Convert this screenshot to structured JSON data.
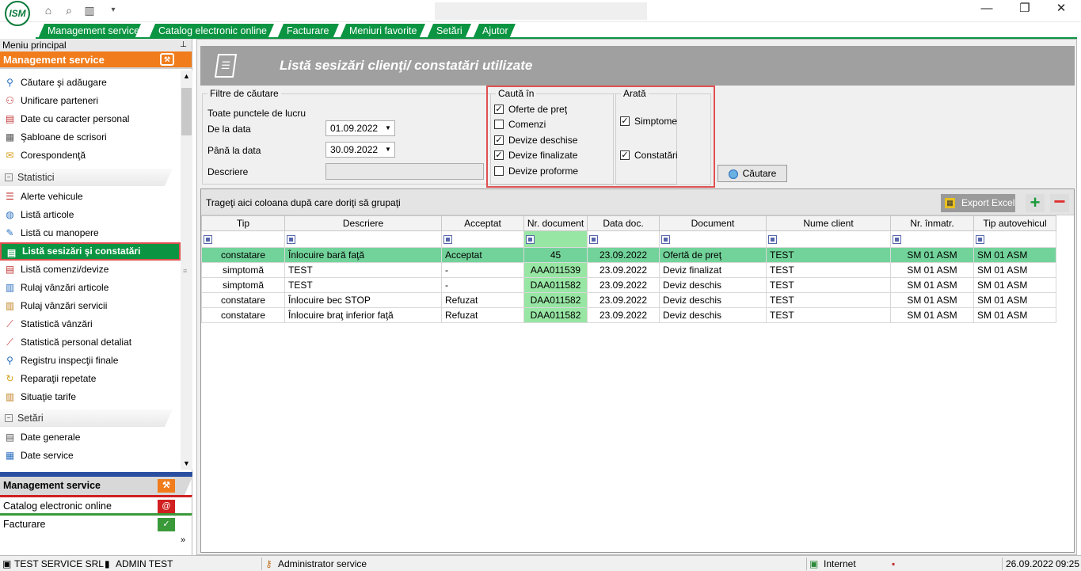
{
  "app": {
    "logo_text": "ISM"
  },
  "menu": {
    "tabs": [
      {
        "label": "Management service"
      },
      {
        "label": "Catalog electronic online"
      },
      {
        "label": "Facturare"
      },
      {
        "label": "Meniuri favorite"
      },
      {
        "label": "Setări"
      },
      {
        "label": "Ajutor"
      }
    ]
  },
  "sidebar": {
    "header": "Meniu principal",
    "category": "Management service",
    "items": [
      {
        "label": "Căutare şi adăugare",
        "icon": "search-person-icon"
      },
      {
        "label": "Unificare parteneri",
        "icon": "users-merge-icon"
      },
      {
        "label": "Date cu caracter personal",
        "icon": "document-lock-icon"
      },
      {
        "label": "Şabloane de scrisori",
        "icon": "letter-template-icon"
      },
      {
        "label": "Corespondenţă",
        "icon": "envelope-icon"
      }
    ],
    "group_statistici": "Statistici",
    "stat_items": [
      {
        "label": "Alerte vehicule"
      },
      {
        "label": "Listă articole"
      },
      {
        "label": "Listă cu manopere"
      },
      {
        "label": "Listă sesizări şi constatări"
      },
      {
        "label": "Listă comenzi/devize"
      },
      {
        "label": "Rulaj vânzări articole"
      },
      {
        "label": "Rulaj vânzări servicii"
      },
      {
        "label": "Statistică vânzări"
      },
      {
        "label": "Statistică personal detaliat"
      },
      {
        "label": "Registru inspecţii finale"
      },
      {
        "label": "Reparaţii repetate"
      },
      {
        "label": "Situaţie tarife"
      }
    ],
    "group_setari": "Setări",
    "setari_items": [
      {
        "label": "Date generale"
      },
      {
        "label": "Date service"
      }
    ],
    "bottom": [
      {
        "label": "Management service"
      },
      {
        "label": "Catalog electronic online"
      },
      {
        "label": "Facturare"
      }
    ]
  },
  "page": {
    "title": "Listă sesizări clienţi/ constatări utilizate"
  },
  "filters": {
    "legend": "Filtre de căutare",
    "all_points": "Toate punctele de lucru",
    "from_label": "De la data",
    "from_value": "01.09.2022",
    "to_label": "Până la data",
    "to_value": "30.09.2022",
    "desc_label": "Descriere",
    "desc_value": ""
  },
  "search_in": {
    "legend": "Caută în",
    "options": [
      {
        "label": "Oferte de preţ",
        "checked": true
      },
      {
        "label": "Comenzi",
        "checked": false
      },
      {
        "label": "Devize deschise",
        "checked": true
      },
      {
        "label": "Devize finalizate",
        "checked": true
      },
      {
        "label": "Devize proforme",
        "checked": false
      }
    ]
  },
  "show": {
    "legend": "Arată",
    "options": [
      {
        "label": "Simptome",
        "checked": true
      },
      {
        "label": "Constatări",
        "checked": true
      }
    ]
  },
  "search_button": "Căutare",
  "grid": {
    "group_hint": "Trageţi aici coloana după care doriţi să grupaţi",
    "export_label": "Export Excel",
    "columns": [
      "Tip",
      "Descriere",
      "Acceptat",
      "Nr. document",
      "Data doc.",
      "Document",
      "Nume client",
      "Nr. înmatr.",
      "Tip autovehicul"
    ],
    "rows": [
      [
        "constatare",
        "Înlocuire bară faţă",
        "Acceptat",
        "45",
        "23.09.2022",
        "Ofertă de preţ",
        "TEST",
        "SM 01 ASM",
        "SM 01 ASM"
      ],
      [
        "simptomă",
        "TEST",
        "-",
        "AAA011539",
        "23.09.2022",
        "Deviz finalizat",
        "TEST",
        "SM 01 ASM",
        "SM 01 ASM"
      ],
      [
        "simptomă",
        "TEST",
        "-",
        "DAA011582",
        "23.09.2022",
        "Deviz deschis",
        "TEST",
        "SM 01 ASM",
        "SM 01 ASM"
      ],
      [
        "constatare",
        "Înlocuire bec STOP",
        "Refuzat",
        "DAA011582",
        "23.09.2022",
        "Deviz deschis",
        "TEST",
        "SM 01 ASM",
        "SM 01 ASM"
      ],
      [
        "constatare",
        "Înlocuire braţ inferior faţă",
        "Refuzat",
        "DAA011582",
        "23.09.2022",
        "Deviz deschis",
        "TEST",
        "SM 01 ASM",
        "SM 01 ASM"
      ]
    ]
  },
  "status": {
    "company": "TEST SERVICE SRL",
    "user": "ADMIN TEST",
    "role": "Administrator service",
    "zone": "Internet",
    "date": "26.09.2022",
    "time": "09:25"
  },
  "colors": {
    "accent_green": "#0b9442",
    "accent_orange": "#f07c1c",
    "selected_row": "#72d39a",
    "highlight": "#e05050"
  }
}
